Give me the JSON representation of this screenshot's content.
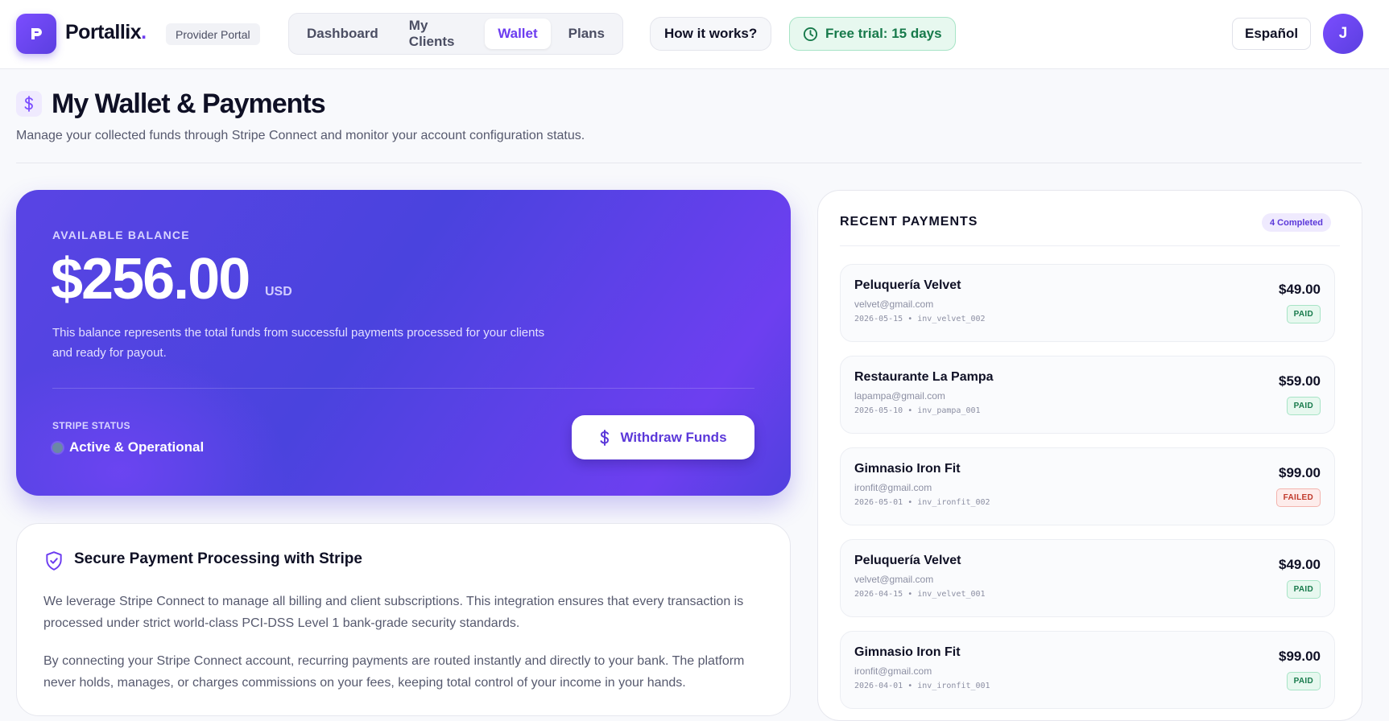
{
  "header": {
    "brand_name": "Portallix",
    "brand_dot": ".",
    "portal_label": "Provider Portal",
    "nav": [
      "Dashboard",
      "My Clients",
      "Wallet",
      "Plans"
    ],
    "active_nav": "Wallet",
    "how_it_works": "How it works?",
    "trial": "Free trial: 15 days",
    "language": "Español",
    "avatar_initial": "J"
  },
  "page": {
    "title": "My Wallet & Payments",
    "subtitle": "Manage your collected funds through Stripe Connect and monitor your account configuration status."
  },
  "balance": {
    "label": "AVAILABLE BALANCE",
    "amount": "$256.00",
    "currency": "USD",
    "description": "This balance represents the total funds from successful payments processed for your clients and ready for payout.",
    "stripe_label": "STRIPE STATUS",
    "stripe_status": "Active & Operational",
    "withdraw_label": "Withdraw Funds"
  },
  "security": {
    "title": "Secure Payment Processing with Stripe",
    "paragraph1": "We leverage Stripe Connect to manage all billing and client subscriptions. This integration ensures that every transaction is processed under strict world-class PCI-DSS Level 1 bank-grade security standards.",
    "paragraph2": "By connecting your Stripe Connect account, recurring payments are routed instantly and directly to your bank. The platform never holds, manages, or charges commissions on your fees, keeping total control of your income in your hands."
  },
  "recent": {
    "title": "RECENT PAYMENTS",
    "badge": "4 Completed",
    "payments": [
      {
        "name": "Peluquería Velvet",
        "email": "velvet@gmail.com",
        "meta": "2026-05-15 • inv_velvet_002",
        "amount": "$49.00",
        "status": "PAID"
      },
      {
        "name": "Restaurante La Pampa",
        "email": "lapampa@gmail.com",
        "meta": "2026-05-10 • inv_pampa_001",
        "amount": "$59.00",
        "status": "PAID"
      },
      {
        "name": "Gimnasio Iron Fit",
        "email": "ironfit@gmail.com",
        "meta": "2026-05-01 • inv_ironfit_002",
        "amount": "$99.00",
        "status": "FAILED"
      },
      {
        "name": "Peluquería Velvet",
        "email": "velvet@gmail.com",
        "meta": "2026-04-15 • inv_velvet_001",
        "amount": "$49.00",
        "status": "PAID"
      },
      {
        "name": "Gimnasio Iron Fit",
        "email": "ironfit@gmail.com",
        "meta": "2026-04-01 • inv_ironfit_001",
        "amount": "$99.00",
        "status": "PAID"
      }
    ]
  },
  "colors": {
    "accent": "#6c3cf0",
    "paid": "#177a4b",
    "failed": "#c0392b"
  }
}
